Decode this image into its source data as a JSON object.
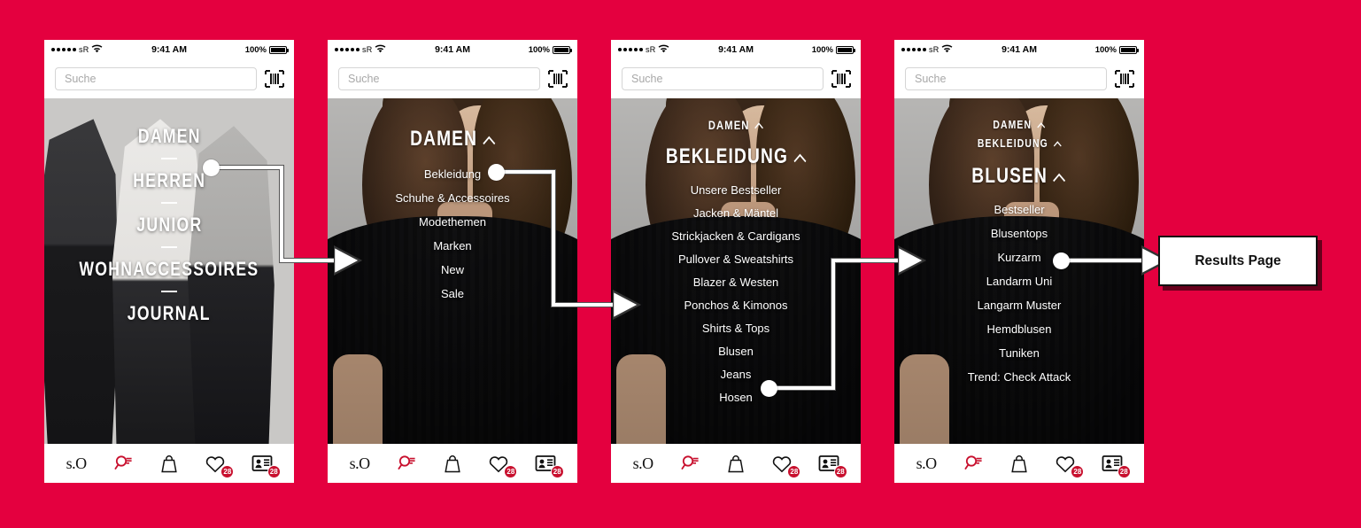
{
  "page": {
    "background_color": "#E4003F",
    "accent_color": "#C8102E"
  },
  "status_bar": {
    "carrier": "sR",
    "time": "9:41 AM",
    "battery_pct": "100%",
    "signal_dots": 5,
    "wifi_icon": "wifi-icon",
    "battery_icon": "battery-full-icon"
  },
  "search": {
    "placeholder": "Suche",
    "value": "",
    "scan_icon": "barcode-scanner-icon"
  },
  "bottom_nav": {
    "items": [
      {
        "name": "brand-logo",
        "icon": "s-oliver-logo",
        "label": "s.O",
        "badge": ""
      },
      {
        "name": "search",
        "icon": "magnifier-icon",
        "label": "",
        "badge": ""
      },
      {
        "name": "bag",
        "icon": "shopping-bag-icon",
        "label": "",
        "badge": ""
      },
      {
        "name": "wishlist",
        "icon": "heart-icon",
        "label": "",
        "badge": "28"
      },
      {
        "name": "account",
        "icon": "id-card-icon",
        "label": "",
        "badge": "28"
      }
    ]
  },
  "screens": [
    {
      "id": "screen-1-main-menu",
      "title": "Hauptmenü",
      "menu_items": [
        "DAMEN",
        "HERREN",
        "JUNIOR",
        "WOHNACCESSOIRES",
        "JOURNAL"
      ],
      "selected": "DAMEN"
    },
    {
      "id": "screen-2-damen",
      "headers": [
        {
          "label": "DAMEN",
          "chevron": "chevron-up-icon",
          "size": "large"
        }
      ],
      "menu_items": [
        "Bekleidung",
        "Schuhe & Accessoires",
        "Modethemen",
        "Marken",
        "New",
        "Sale"
      ],
      "selected": "Bekleidung"
    },
    {
      "id": "screen-3-bekleidung",
      "headers": [
        {
          "label": "DAMEN",
          "chevron": "chevron-up-icon",
          "size": "small"
        },
        {
          "label": "BEKLEIDUNG",
          "chevron": "chevron-up-icon",
          "size": "large"
        }
      ],
      "menu_items": [
        "Unsere Bestseller",
        "Jacken & Mäntel",
        "Strickjacken & Cardigans",
        "Pullover & Sweatshirts",
        "Blazer & Westen",
        "Ponchos & Kimonos",
        "Shirts & Tops",
        "Blusen",
        "Jeans",
        "Hosen"
      ],
      "selected": "Blusen"
    },
    {
      "id": "screen-4-blusen",
      "headers": [
        {
          "label": "DAMEN",
          "chevron": "chevron-up-icon",
          "size": "small"
        },
        {
          "label": "BEKLEIDUNG",
          "chevron": "chevron-up-icon",
          "size": "small"
        },
        {
          "label": "BLUSEN",
          "chevron": "chevron-up-icon",
          "size": "large"
        }
      ],
      "menu_items": [
        "Bestseller",
        "Blusentops",
        "Kurzarm",
        "Landarm Uni",
        "Langarm Muster",
        "Hemdblusen",
        "Tuniken",
        "Trend: Check Attack"
      ],
      "selected": "Blusentops"
    }
  ],
  "result_box": {
    "label": "Results Page"
  },
  "connectors": [
    {
      "from": "screen-1-damen",
      "to": "screen-2",
      "icon": "arrow-right-icon"
    },
    {
      "from": "screen-2-bekleidung",
      "to": "screen-3",
      "icon": "arrow-right-icon"
    },
    {
      "from": "screen-3-blusen",
      "to": "screen-4",
      "icon": "arrow-right-icon"
    },
    {
      "from": "screen-4-blusentops",
      "to": "results-page",
      "icon": "arrow-right-icon"
    }
  ]
}
